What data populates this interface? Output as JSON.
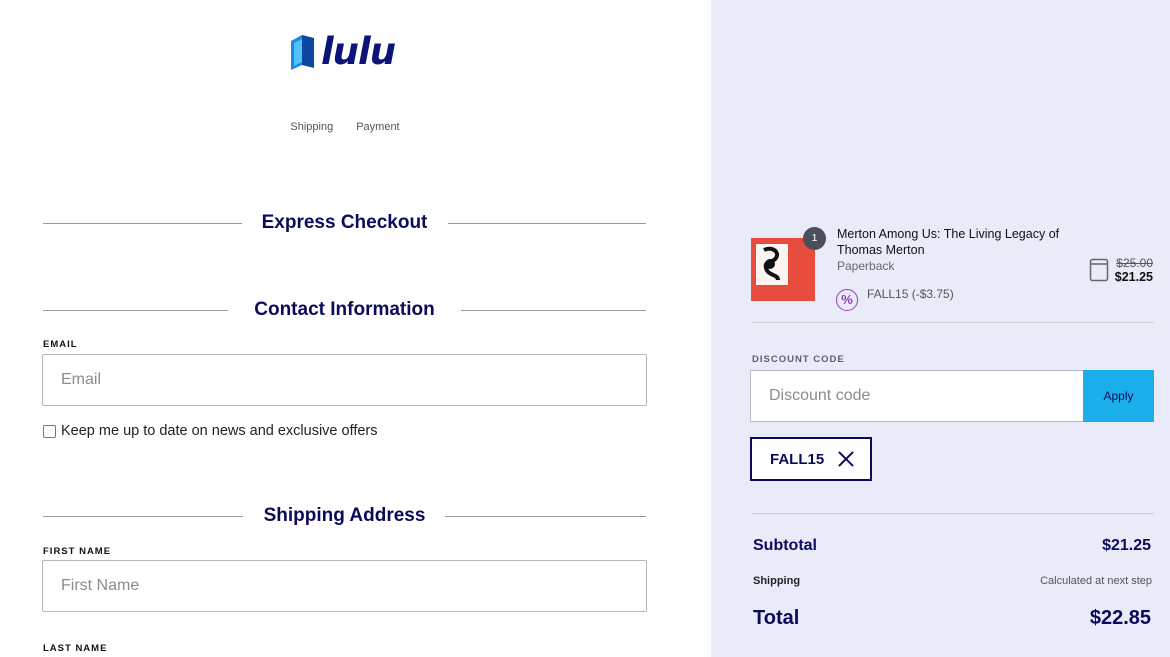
{
  "brand": {
    "logo_text": "lulu",
    "color": "#0d1478"
  },
  "steps": [
    "Shipping",
    "Payment"
  ],
  "sections": {
    "express": "Express Checkout",
    "contact": "Contact Information",
    "shipping": "Shipping Address"
  },
  "contact": {
    "email_label": "EMAIL",
    "email_placeholder": "Email",
    "newsletter_label": "Keep me up to date on news and exclusive offers",
    "newsletter_checked": false
  },
  "shipping": {
    "first_name_label": "FIRST NAME",
    "first_name_placeholder": "First Name",
    "last_name_label": "LAST NAME"
  },
  "order": {
    "quantity": "1",
    "title": "Merton Among Us: The Living Legacy of Thomas Merton",
    "format": "Paperback",
    "discount_applied": "FALL15 (-$3.75)",
    "discount_icon": "%",
    "price_original": "$25.00",
    "price_discounted": "$21.25"
  },
  "discount": {
    "label": "DISCOUNT CODE",
    "placeholder": "Discount code",
    "apply_label": "Apply",
    "applied_code": "FALL15"
  },
  "summary": {
    "subtotal_label": "Subtotal",
    "subtotal_value": "$21.25",
    "shipping_label": "Shipping",
    "shipping_value": "Calculated at next step",
    "total_label": "Total",
    "total_value": "$22.85"
  },
  "colors": {
    "navy": "#0b0b5c",
    "panel_bg": "#e9ebf8",
    "apply_bg": "#1aaeea",
    "discount_icon": "#9b3bb8"
  }
}
